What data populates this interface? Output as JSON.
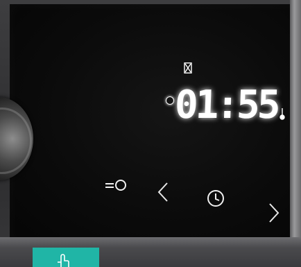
{
  "display": {
    "time": "01:55"
  },
  "icons": {
    "timer": "hourglass-icon",
    "info": "info-icon",
    "temperature": "thermometer-icon",
    "lock": "key-lock-icon",
    "previous": "chevron-left-icon",
    "clock": "clock-icon",
    "next": "chevron-right-icon",
    "badge": "hand-pointer-icon"
  },
  "colors": {
    "panel": "#0b0b0b",
    "display": "#ffffff",
    "badge": "#20b5a6"
  }
}
